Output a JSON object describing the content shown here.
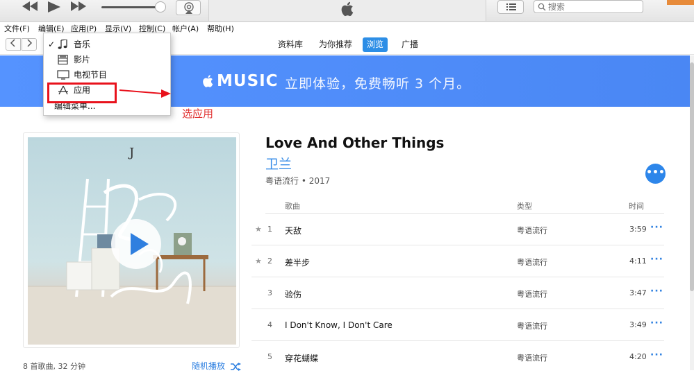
{
  "toolbar": {
    "search_placeholder": "搜索"
  },
  "menubar": {
    "items": [
      "文件(F)",
      "编辑(E)",
      "应用(P)",
      "显示(V)",
      "控制(C)",
      "帐户(A)",
      "帮助(H)"
    ]
  },
  "nav": {
    "tabs": [
      "资料库",
      "为你推荐",
      "浏览",
      "广播"
    ],
    "active_tab": "浏览"
  },
  "dropdown": {
    "items": [
      {
        "label": "音乐",
        "icon": "music-note-icon",
        "checked": true
      },
      {
        "label": "影片",
        "icon": "film-icon",
        "checked": false
      },
      {
        "label": "电视节目",
        "icon": "tv-icon",
        "checked": false
      },
      {
        "label": "应用",
        "icon": "app-store-icon",
        "checked": false
      }
    ],
    "edit_menu": "编辑菜单..."
  },
  "annotation": {
    "text": "选应用",
    "color": "#e0302f"
  },
  "banner": {
    "brand": "MUSIC",
    "text": "立即体验，免费畅听 3 个月。",
    "color": "#5593ff"
  },
  "album": {
    "title": "Love And Other Things",
    "artist": "卫兰",
    "genre_year": "粤语流行 • 2017",
    "meta": "8 首歌曲, 32 分钟",
    "shuffle": "随机播放"
  },
  "tracks": {
    "headers": {
      "song": "歌曲",
      "genre": "类型",
      "time": "时间"
    },
    "rows": [
      {
        "star": "★",
        "num": "1",
        "name": "天敌",
        "genre": "粤语流行",
        "time": "3:59"
      },
      {
        "star": "★",
        "num": "2",
        "name": "差半步",
        "genre": "粤语流行",
        "time": "4:11"
      },
      {
        "star": "",
        "num": "3",
        "name": "验伤",
        "genre": "粤语流行",
        "time": "3:47"
      },
      {
        "star": "",
        "num": "4",
        "name": "I Don't Know, I Don't Care",
        "genre": "粤语流行",
        "time": "3:49"
      },
      {
        "star": "",
        "num": "5",
        "name": "穿花蝴蝶",
        "genre": "粤语流行",
        "time": "4:20"
      }
    ]
  },
  "colors": {
    "accent": "#2d8ee6",
    "highlight": "#e8121c"
  }
}
